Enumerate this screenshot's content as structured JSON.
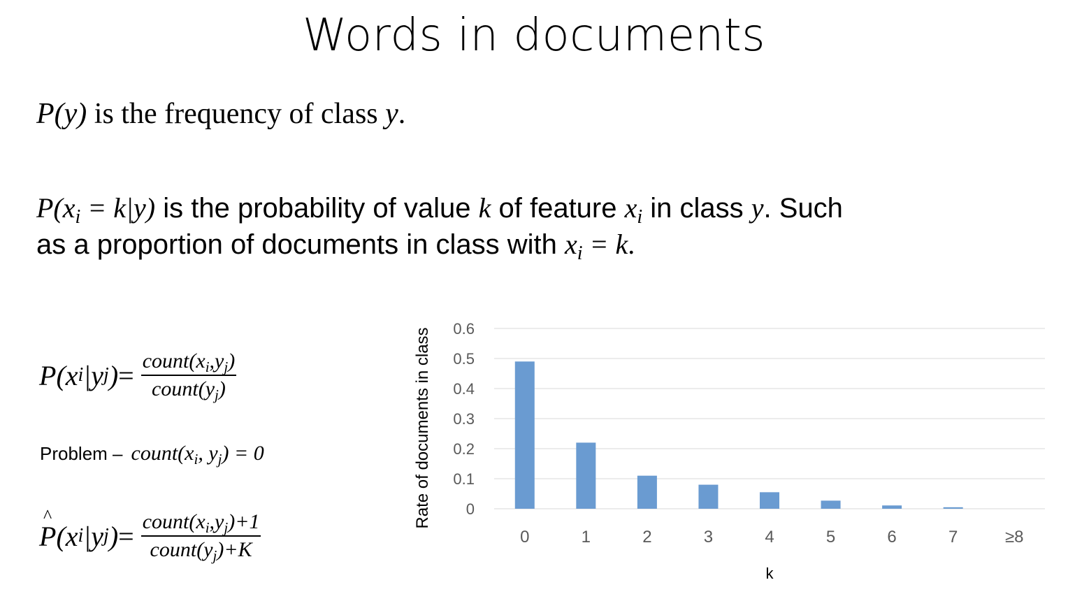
{
  "title": "Words in documents",
  "line1": {
    "math": "P(y)",
    "text": " is the frequency of class ",
    "var": "y",
    "end": "."
  },
  "line2": {
    "math": "P(x",
    "sub": "i",
    "math2": " = k|y)",
    "text1": " is the probability of value ",
    "k": "k",
    "text2": " of feature ",
    "x": "x",
    "xsub": "i",
    "text3": " in class ",
    "y": "y",
    "text4": ". Such"
  },
  "line3": {
    "text": "as a proportion of documents in class with ",
    "x": "x",
    "xsub": "i",
    "eq": " = k",
    "end": "."
  },
  "eq1": {
    "lhs_a": "P",
    "lhs_b": "(x",
    "lhs_sub_i": "i",
    "lhs_c": "|y",
    "lhs_sub_j": "j",
    "lhs_d": ")",
    "equals": " =",
    "num": "count(x",
    "num_sub_i": "i",
    "num_mid": ",y",
    "num_sub_j": "j",
    "num_end": ")",
    "den": "count(y",
    "den_sub_j": "j",
    "den_end": ")"
  },
  "problem": {
    "label": "Problem –",
    "expr_a": "count(x",
    "expr_sub_i": "i",
    "expr_b": ", y",
    "expr_sub_j": "j",
    "expr_c": ") = 0"
  },
  "eq2": {
    "lhs_a": "P",
    "lhs_b": "(x",
    "lhs_sub_i": "i",
    "lhs_c": "|y",
    "lhs_sub_j": "j",
    "lhs_d": ")",
    "equals": " =",
    "num": "count(x",
    "num_sub_i": "i",
    "num_mid": ",y",
    "num_sub_j": "j",
    "num_end": ")+1",
    "den": "count(y",
    "den_sub_j": "j",
    "den_end": ")+K"
  },
  "chart_data": {
    "type": "bar",
    "categories": [
      "0",
      "1",
      "2",
      "3",
      "4",
      "5",
      "6",
      "7",
      "≥8"
    ],
    "values": [
      0.49,
      0.22,
      0.11,
      0.08,
      0.055,
      0.027,
      0.011,
      0.005,
      0.0
    ],
    "xlabel": "k",
    "ylabel": "Rate of documents in class",
    "ylim": [
      0,
      0.6
    ],
    "yticks": [
      "0",
      "0.1",
      "0.2",
      "0.3",
      "0.4",
      "0.5",
      "0.6"
    ],
    "grid": true,
    "bar_color": "#6a9bd1",
    "grid_color": "#d9d9d9"
  }
}
